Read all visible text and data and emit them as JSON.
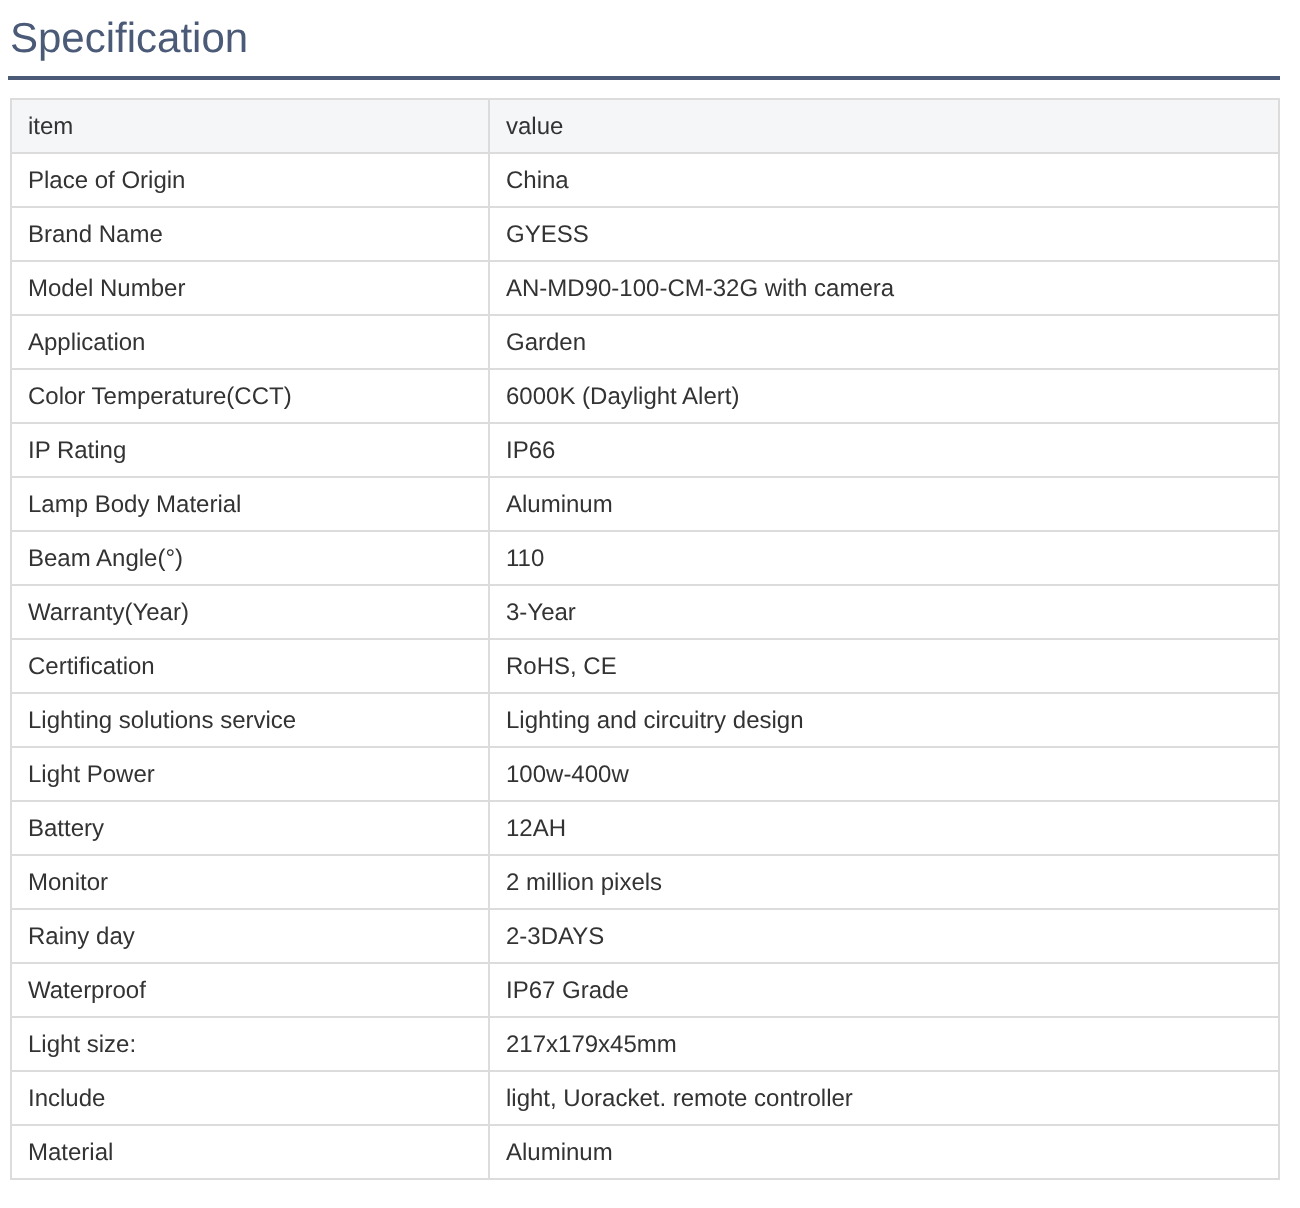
{
  "title": "Specification",
  "table": {
    "columns": [
      "item",
      "value"
    ],
    "rows": [
      [
        "Place of Origin",
        "China"
      ],
      [
        "Brand Name",
        "GYESS"
      ],
      [
        "Model Number",
        "AN-MD90-100-CM-32G with camera"
      ],
      [
        "Application",
        "Garden"
      ],
      [
        "Color Temperature(CCT)",
        "6000K (Daylight Alert)"
      ],
      [
        "IP Rating",
        "IP66"
      ],
      [
        "Lamp Body Material",
        "Aluminum"
      ],
      [
        "Beam Angle(°)",
        "110"
      ],
      [
        "Warranty(Year)",
        "3-Year"
      ],
      [
        "Certification",
        "RoHS, CE"
      ],
      [
        "Lighting solutions service",
        "Lighting and circuitry design"
      ],
      [
        "Light Power",
        "100w-400w"
      ],
      [
        "Battery",
        "12AH"
      ],
      [
        "Monitor",
        "2 million pixels"
      ],
      [
        "Rainy day",
        "2-3DAYS"
      ],
      [
        "Waterproof",
        "IP67 Grade"
      ],
      [
        "Light size:",
        "217x179x45mm"
      ],
      [
        "Include",
        "light, Uoracket. remote controller"
      ],
      [
        "Material",
        "Aluminum"
      ]
    ]
  }
}
